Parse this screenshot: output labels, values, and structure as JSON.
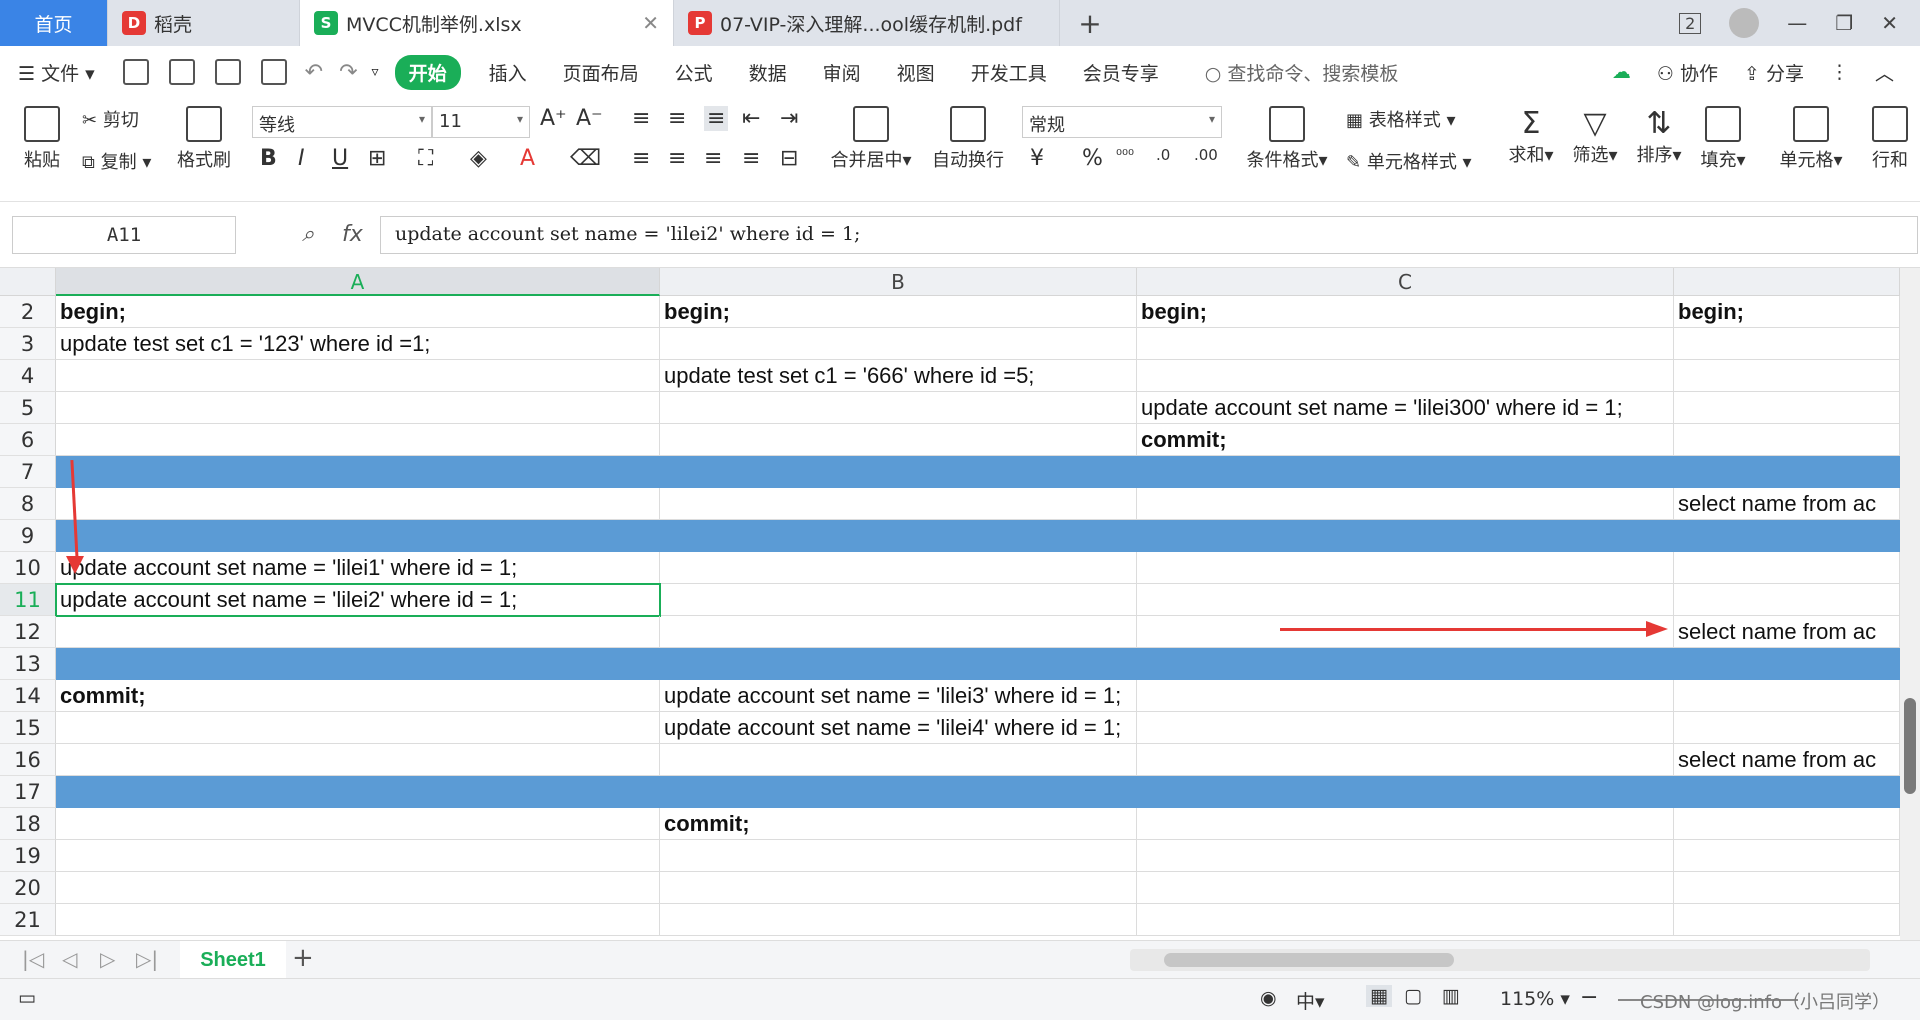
{
  "tabs": {
    "home": "首页",
    "daoke": "稻壳",
    "active_file": "MVCC机制举例.xlsx",
    "pdf_file": "07-VIP-深入理解...ool缓存机制.pdf",
    "add": "+",
    "window_badge": "2"
  },
  "menu": {
    "file": "文件",
    "start": "开始",
    "insert": "插入",
    "layout": "页面布局",
    "formula": "公式",
    "data": "数据",
    "review": "审阅",
    "view": "视图",
    "dev": "开发工具",
    "member": "会员专享",
    "search": "查找命令、搜索模板",
    "collab": "协作",
    "share": "分享"
  },
  "ribbon": {
    "paste": "粘贴",
    "cut": "剪切",
    "copy": "复制",
    "format_painter": "格式刷",
    "font_name": "等线",
    "font_size": "11",
    "merge": "合并居中",
    "wrap": "自动换行",
    "number_format": "常规",
    "cond_format": "条件格式",
    "table_style": "表格样式",
    "cell_style": "单元格样式",
    "sum": "求和",
    "filter": "筛选",
    "sort": "排序",
    "fill": "填充",
    "cell": "单元格",
    "rowcol": "行和",
    "currency": "¥",
    "percent": "%"
  },
  "formula_bar": {
    "name_box": "A11",
    "fx": "fx",
    "content": "update account set name = 'lilei2' where id = 1;"
  },
  "columns": [
    "A",
    "B",
    "C",
    ""
  ],
  "rows": [
    {
      "n": "2",
      "cells": [
        {
          "t": "begin;",
          "b": true
        },
        {
          "t": "begin;",
          "b": true
        },
        {
          "t": "begin;",
          "b": true
        },
        {
          "t": "begin;",
          "b": true
        }
      ]
    },
    {
      "n": "3",
      "cells": [
        {
          "t": "update test set c1 = '123' where id =1;"
        },
        {
          "t": ""
        },
        {
          "t": ""
        },
        {
          "t": ""
        }
      ]
    },
    {
      "n": "4",
      "cells": [
        {
          "t": ""
        },
        {
          "t": "update test set c1 = '666' where id =5;"
        },
        {
          "t": ""
        },
        {
          "t": ""
        }
      ]
    },
    {
      "n": "5",
      "cells": [
        {
          "t": ""
        },
        {
          "t": ""
        },
        {
          "t": "update account set name = 'lilei300' where id = 1;"
        },
        {
          "t": ""
        }
      ]
    },
    {
      "n": "6",
      "cells": [
        {
          "t": ""
        },
        {
          "t": ""
        },
        {
          "t": "commit;",
          "b": true
        },
        {
          "t": ""
        }
      ]
    },
    {
      "n": "7",
      "blue": true,
      "cells": [
        {
          "t": ""
        },
        {
          "t": ""
        },
        {
          "t": ""
        },
        {
          "t": ""
        }
      ]
    },
    {
      "n": "8",
      "cells": [
        {
          "t": ""
        },
        {
          "t": ""
        },
        {
          "t": ""
        },
        {
          "t": "select name from ac"
        }
      ]
    },
    {
      "n": "9",
      "blue": true,
      "cells": [
        {
          "t": ""
        },
        {
          "t": ""
        },
        {
          "t": ""
        },
        {
          "t": ""
        }
      ]
    },
    {
      "n": "10",
      "cells": [
        {
          "t": "update account set name = 'lilei1' where id = 1;"
        },
        {
          "t": ""
        },
        {
          "t": ""
        },
        {
          "t": ""
        }
      ]
    },
    {
      "n": "11",
      "sel": true,
      "cells": [
        {
          "t": "update account set name = 'lilei2' where id = 1;"
        },
        {
          "t": ""
        },
        {
          "t": ""
        },
        {
          "t": ""
        }
      ]
    },
    {
      "n": "12",
      "cells": [
        {
          "t": ""
        },
        {
          "t": ""
        },
        {
          "t": ""
        },
        {
          "t": "select name from ac"
        }
      ]
    },
    {
      "n": "13",
      "blue": true,
      "cells": [
        {
          "t": ""
        },
        {
          "t": ""
        },
        {
          "t": ""
        },
        {
          "t": ""
        }
      ]
    },
    {
      "n": "14",
      "cells": [
        {
          "t": "commit;",
          "b": true
        },
        {
          "t": "update account set name = 'lilei3' where id = 1;"
        },
        {
          "t": ""
        },
        {
          "t": ""
        }
      ]
    },
    {
      "n": "15",
      "cells": [
        {
          "t": ""
        },
        {
          "t": "update account set name = 'lilei4' where id = 1;"
        },
        {
          "t": ""
        },
        {
          "t": ""
        }
      ]
    },
    {
      "n": "16",
      "cells": [
        {
          "t": ""
        },
        {
          "t": ""
        },
        {
          "t": ""
        },
        {
          "t": "select name from ac"
        }
      ]
    },
    {
      "n": "17",
      "blue": true,
      "cells": [
        {
          "t": ""
        },
        {
          "t": ""
        },
        {
          "t": ""
        },
        {
          "t": ""
        }
      ]
    },
    {
      "n": "18",
      "cells": [
        {
          "t": ""
        },
        {
          "t": "commit;",
          "b": true
        },
        {
          "t": ""
        },
        {
          "t": ""
        }
      ]
    },
    {
      "n": "19",
      "cells": [
        {
          "t": ""
        },
        {
          "t": ""
        },
        {
          "t": ""
        },
        {
          "t": ""
        }
      ]
    },
    {
      "n": "20",
      "cells": [
        {
          "t": ""
        },
        {
          "t": ""
        },
        {
          "t": ""
        },
        {
          "t": ""
        }
      ]
    },
    {
      "n": "21",
      "cells": [
        {
          "t": ""
        },
        {
          "t": ""
        },
        {
          "t": ""
        },
        {
          "t": ""
        }
      ]
    }
  ],
  "sheets": {
    "active": "Sheet1",
    "add": "+"
  },
  "statusbar": {
    "zoom": "115%",
    "watermark": "CSDN @log.info（小吕同学）"
  },
  "colors": {
    "accent": "#1aae58",
    "highlight_row": "#5b9bd5",
    "arrow": "#e53935",
    "home_tab": "#3a84e6"
  }
}
